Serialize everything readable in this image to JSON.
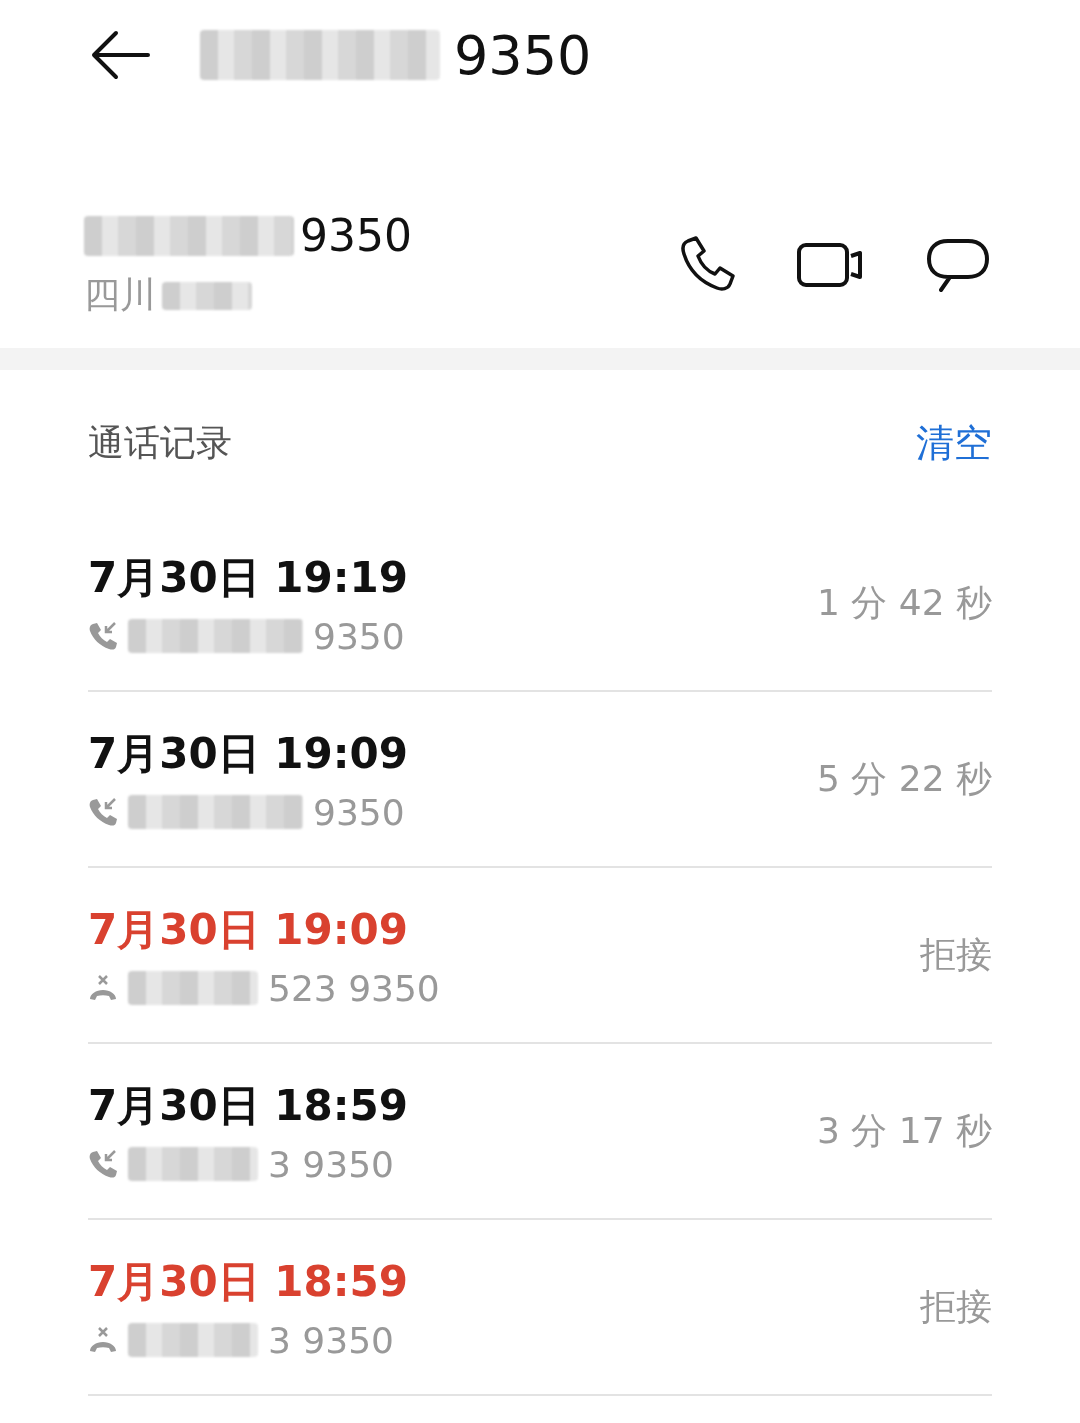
{
  "header": {
    "title": "9350"
  },
  "contact": {
    "number": "9350",
    "location": "四川"
  },
  "call_log": {
    "title": "通话记录",
    "clear": "清空",
    "entries": [
      {
        "time": "7月30日 19:19",
        "number": "9350",
        "kind": "incoming",
        "result": "1 分 42 秒"
      },
      {
        "time": "7月30日 19:09",
        "number": "9350",
        "kind": "incoming",
        "result": "5 分 22 秒"
      },
      {
        "time": "7月30日 19:09",
        "number": "523 9350",
        "kind": "rejected",
        "result": "拒接"
      },
      {
        "time": "7月30日 18:59",
        "number": "3 9350",
        "kind": "incoming",
        "result": "3 分 17 秒"
      },
      {
        "time": "7月30日 18:59",
        "number": "3 9350",
        "kind": "rejected",
        "result": "拒接"
      }
    ]
  }
}
